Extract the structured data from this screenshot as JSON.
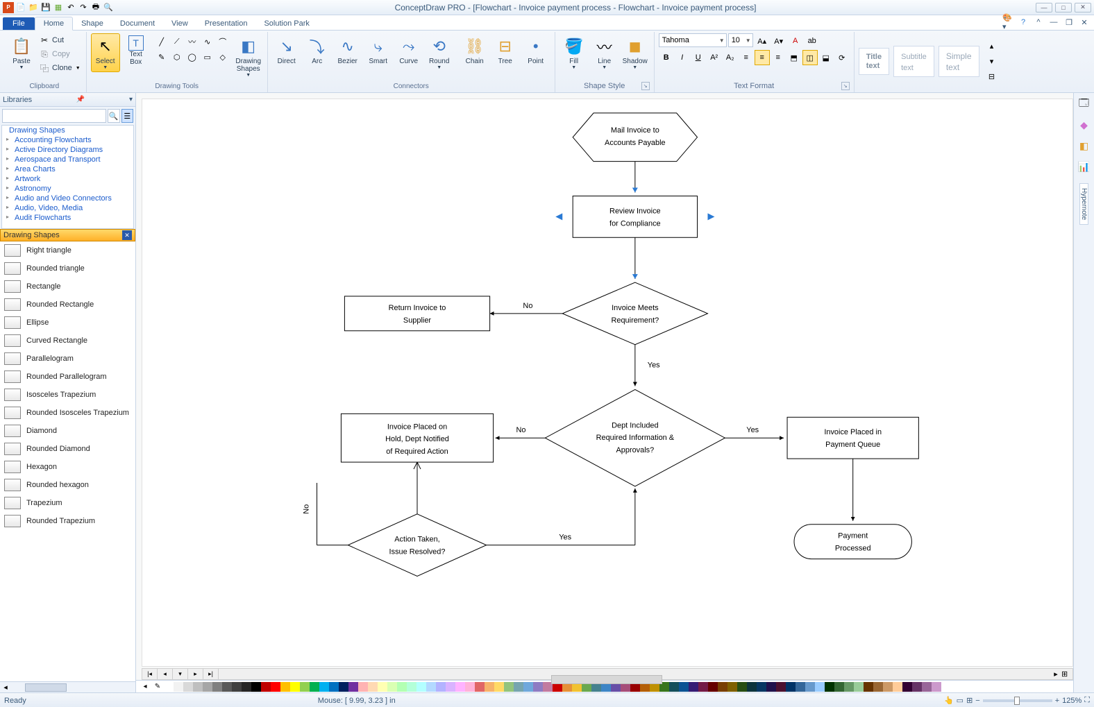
{
  "title": "ConceptDraw PRO - [Flowchart - Invoice payment process - Flowchart - Invoice payment process]",
  "tabs": {
    "file": "File",
    "items": [
      "Home",
      "Shape",
      "Document",
      "View",
      "Presentation",
      "Solution Park"
    ],
    "active": 0
  },
  "ribbon": {
    "clipboard": {
      "paste": "Paste",
      "cut": "Cut",
      "copy": "Copy",
      "clone": "Clone",
      "label": "Clipboard"
    },
    "drawing": {
      "select": "Select",
      "textbox": "Text\nBox",
      "drawingshapes": "Drawing\nShapes",
      "label": "Drawing Tools"
    },
    "connectors": {
      "direct": "Direct",
      "arc": "Arc",
      "bezier": "Bezier",
      "smart": "Smart",
      "curve": "Curve",
      "round": "Round",
      "chain": "Chain",
      "tree": "Tree",
      "point": "Point",
      "label": "Connectors"
    },
    "shapestyle": {
      "fill": "Fill",
      "line": "Line",
      "shadow": "Shadow",
      "label": "Shape Style"
    },
    "textformat": {
      "font": "Tahoma",
      "size": "10",
      "label": "Text Format"
    },
    "styles": {
      "title": "Title\ntext",
      "subtitle": "Subtitle\ntext",
      "simple": "Simple\ntext"
    }
  },
  "libraries": {
    "header": "Libraries",
    "tree": [
      "Drawing Shapes",
      "Accounting Flowcharts",
      "Active Directory Diagrams",
      "Aerospace and Transport",
      "Area Charts",
      "Artwork",
      "Astronomy",
      "Audio and Video Connectors",
      "Audio, Video, Media",
      "Audit Flowcharts"
    ],
    "shapesheader": "Drawing Shapes",
    "shapes": [
      "Right triangle",
      "Rounded triangle",
      "Rectangle",
      "Rounded Rectangle",
      "Ellipse",
      "Curved Rectangle",
      "Parallelogram",
      "Rounded Parallelogram",
      "Isosceles Trapezium",
      "Rounded Isosceles Trapezium",
      "Diamond",
      "Rounded Diamond",
      "Hexagon",
      "Rounded hexagon",
      "Trapezium",
      "Rounded Trapezium"
    ]
  },
  "rightstrip": {
    "hypernote": "Hypernote"
  },
  "flow": {
    "n1": "Mail Invoice to Accounts Payable",
    "n2": "Review Invoice for Compliance",
    "n3": "Invoice Meets Requirement?",
    "n4": "Return Invoice to Supplier",
    "n5": "Dept Included Required Information & Approvals?",
    "n6": "Invoice Placed on Hold, Dept Notified of Required Action",
    "n7": "Invoice Placed in Payment Queue",
    "n8": "Action Taken, Issue Resolved?",
    "n9": "Payment Processed",
    "yes": "Yes",
    "no": "No"
  },
  "palette": [
    "#ffffff",
    "#f2f2f2",
    "#d9d9d9",
    "#bfbfbf",
    "#a6a6a6",
    "#808080",
    "#595959",
    "#404040",
    "#262626",
    "#000000",
    "#c00000",
    "#ff0000",
    "#ffc000",
    "#ffff00",
    "#92d050",
    "#00b050",
    "#00b0f0",
    "#0070c0",
    "#002060",
    "#7030a0",
    "#ffb3b3",
    "#ffd9b3",
    "#ffffb3",
    "#d9ffb3",
    "#b3ffb3",
    "#b3ffd9",
    "#b3ffff",
    "#b3d9ff",
    "#b3b3ff",
    "#d9b3ff",
    "#ffb3ff",
    "#ffb3d9",
    "#e06666",
    "#f6b26b",
    "#ffd966",
    "#93c47d",
    "#76a5af",
    "#6fa8dc",
    "#8e7cc3",
    "#c27ba0",
    "#cc0000",
    "#e69138",
    "#f1c232",
    "#6aa84f",
    "#45818e",
    "#3d85c6",
    "#674ea7",
    "#a64d79",
    "#990000",
    "#b45f06",
    "#bf9000",
    "#38761d",
    "#134f5c",
    "#0b5394",
    "#351c75",
    "#741b47",
    "#660000",
    "#783f04",
    "#7f6000",
    "#274e13",
    "#0c343d",
    "#073763",
    "#20124d",
    "#4c1130",
    "#003366",
    "#336699",
    "#6699cc",
    "#99ccff",
    "#003300",
    "#336633",
    "#669966",
    "#99cc99",
    "#663300",
    "#996633",
    "#cc9966",
    "#ffcc99",
    "#330033",
    "#663366",
    "#996699",
    "#cc99cc"
  ],
  "status": {
    "ready": "Ready",
    "mouse": "Mouse: [ 9.99, 3.23 ] in",
    "zoom": "125%"
  }
}
